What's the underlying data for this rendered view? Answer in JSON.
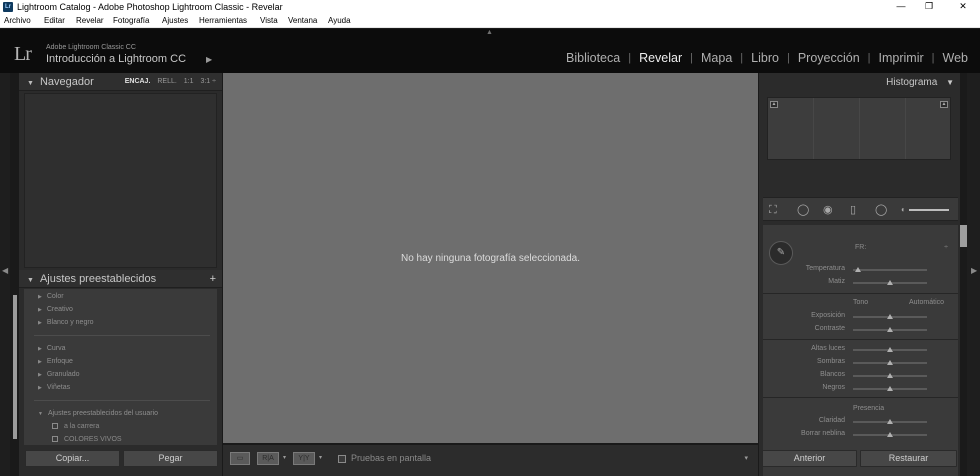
{
  "window": {
    "icon_text": "Lr",
    "title": "Lightroom Catalog - Adobe Photoshop Lightroom Classic - Revelar",
    "minimize": "—",
    "maximize": "❐",
    "close": "✕"
  },
  "menu": [
    "Archivo",
    "Editar",
    "Revelar",
    "Fotografía",
    "Ajustes",
    "Herramientas",
    "Vista",
    "Ventana",
    "Ayuda"
  ],
  "identity": {
    "logo": "Lr",
    "product": "Adobe Lightroom Classic CC",
    "catalog": "Introducción a Lightroom CC",
    "caret": "▶"
  },
  "modules": [
    {
      "label": "Biblioteca",
      "active": false
    },
    {
      "label": "Revelar",
      "active": true
    },
    {
      "label": "Mapa",
      "active": false
    },
    {
      "label": "Libro",
      "active": false
    },
    {
      "label": "Proyección",
      "active": false
    },
    {
      "label": "Imprimir",
      "active": false
    },
    {
      "label": "Web",
      "active": false
    }
  ],
  "navigator": {
    "title": "Navegador",
    "options": [
      "ENCAJ.",
      "RELL.",
      "1:1",
      "3:1 ÷"
    ]
  },
  "presets": {
    "title": "Ajustes preestablecidos",
    "add": "+",
    "groups1": [
      "Color",
      "Creativo",
      "Blanco y negro"
    ],
    "groups2": [
      "Curva",
      "Enfoque",
      "Granulado",
      "Viñetas"
    ],
    "user_group": "Ajustes preestablecidos del usuario",
    "user_items": [
      "a la carrera",
      "COLORES VIVOS"
    ]
  },
  "left_buttons": {
    "copy": "Copiar...",
    "paste": "Pegar"
  },
  "center": {
    "message": "No hay ninguna fotografía seleccionada."
  },
  "toolbar": {
    "view_single": "▭",
    "view_ra": "R|A",
    "view_yy": "Y|Y",
    "caret": "▾",
    "soft_proof": "Pruebas en pantalla",
    "menu": "▾"
  },
  "histogram": {
    "title": "Histograma",
    "collapse": "◀"
  },
  "basic": {
    "wb_value": "FR:",
    "wb_arrows": "÷",
    "temp": "Temperatura",
    "tint": "Matiz",
    "tone_label": "Tono",
    "auto_label": "Automático",
    "exposure": "Exposición",
    "contrast": "Contraste",
    "highlights": "Altas luces",
    "shadows": "Sombras",
    "whites": "Blancos",
    "blacks": "Negros",
    "presence": "Presencia",
    "clarity": "Claridad",
    "dehaze": "Borrar neblina"
  },
  "right_buttons": {
    "previous": "Anterior",
    "reset": "Restaurar"
  }
}
